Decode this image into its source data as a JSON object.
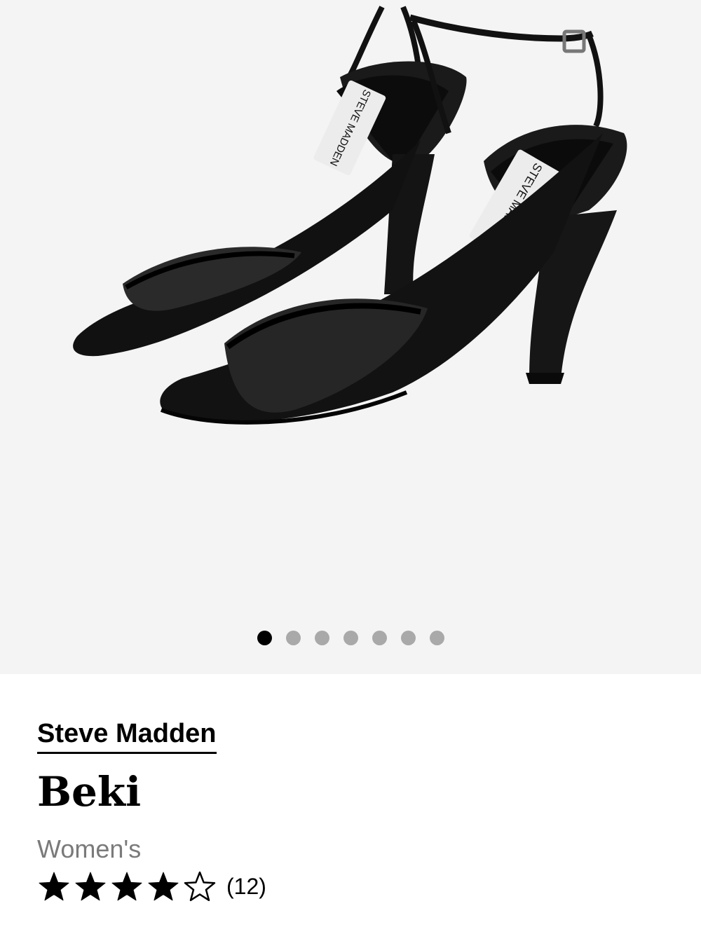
{
  "gallery": {
    "image_alt": "Steve Madden Beki black mesh heeled sandals",
    "insole_label": "STEVE MADDEN",
    "dots_total": 7,
    "active_index": 0,
    "colors": {
      "background": "#f4f4f4",
      "active_dot": "#000000",
      "inactive_dot": "#a9a9a9"
    }
  },
  "product": {
    "brand": "Steve Madden",
    "name": "Beki",
    "gender": "Women's",
    "rating": {
      "stars": 4,
      "max_stars": 5,
      "review_count_label": "(12)"
    }
  }
}
